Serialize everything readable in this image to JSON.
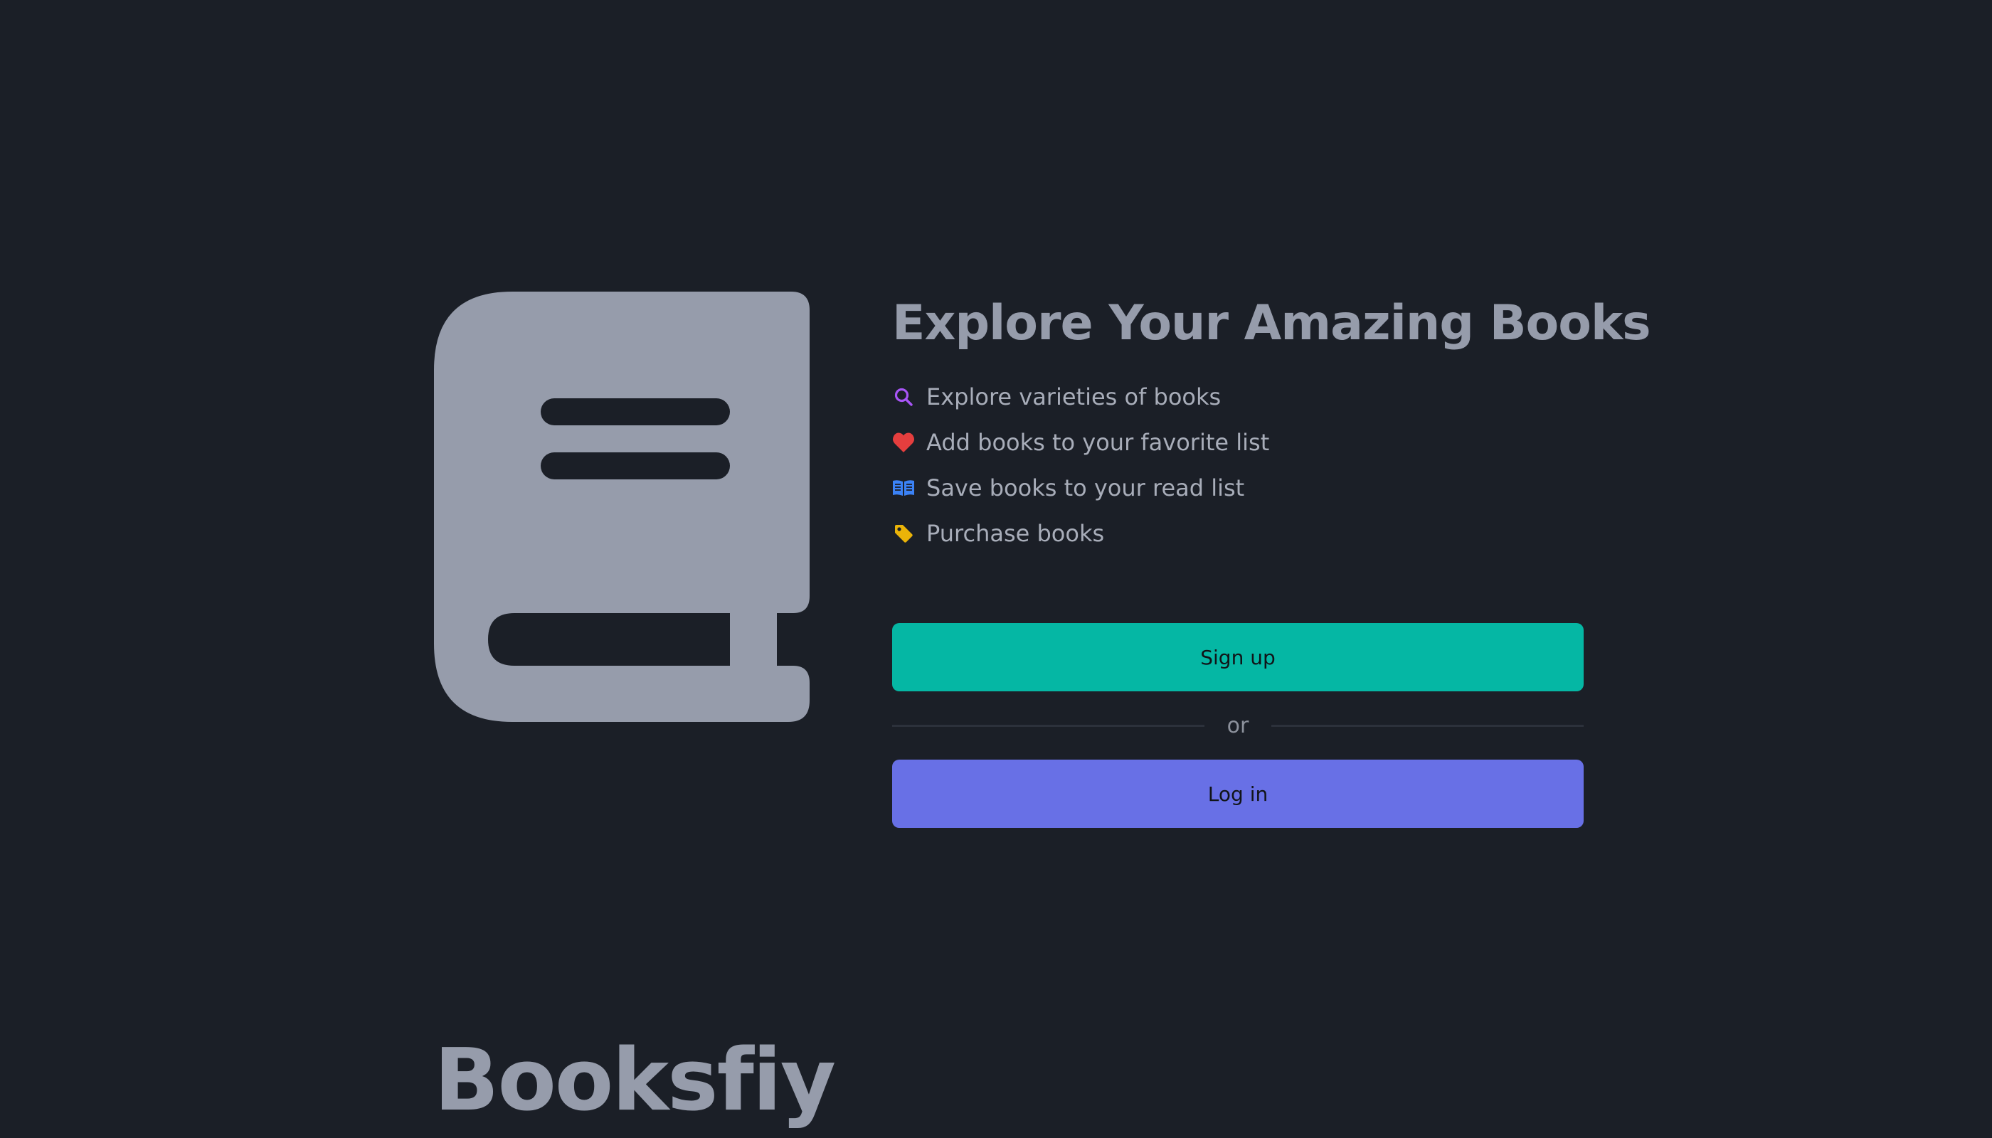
{
  "brand": {
    "name": "Booksfiy",
    "logo_icon": "book-icon",
    "logo_color": "#969cab"
  },
  "hero": {
    "headline": "Explore Your Amazing Books"
  },
  "features": [
    {
      "icon": "search-icon",
      "color": "#a855f7",
      "label": "Explore varieties of books"
    },
    {
      "icon": "heart-icon",
      "color": "#e53e3e",
      "label": "Add books to your favorite list"
    },
    {
      "icon": "open-book-icon",
      "color": "#3b82f6",
      "label": "Save books to your read list"
    },
    {
      "icon": "tag-icon",
      "color": "#eab308",
      "label": "Purchase books"
    }
  ],
  "actions": {
    "signup_label": "Sign up",
    "divider_label": "or",
    "login_label": "Log in",
    "signup_color": "#05b7a4",
    "login_color": "#6870e6"
  },
  "theme": {
    "background": "#1b1f27"
  }
}
